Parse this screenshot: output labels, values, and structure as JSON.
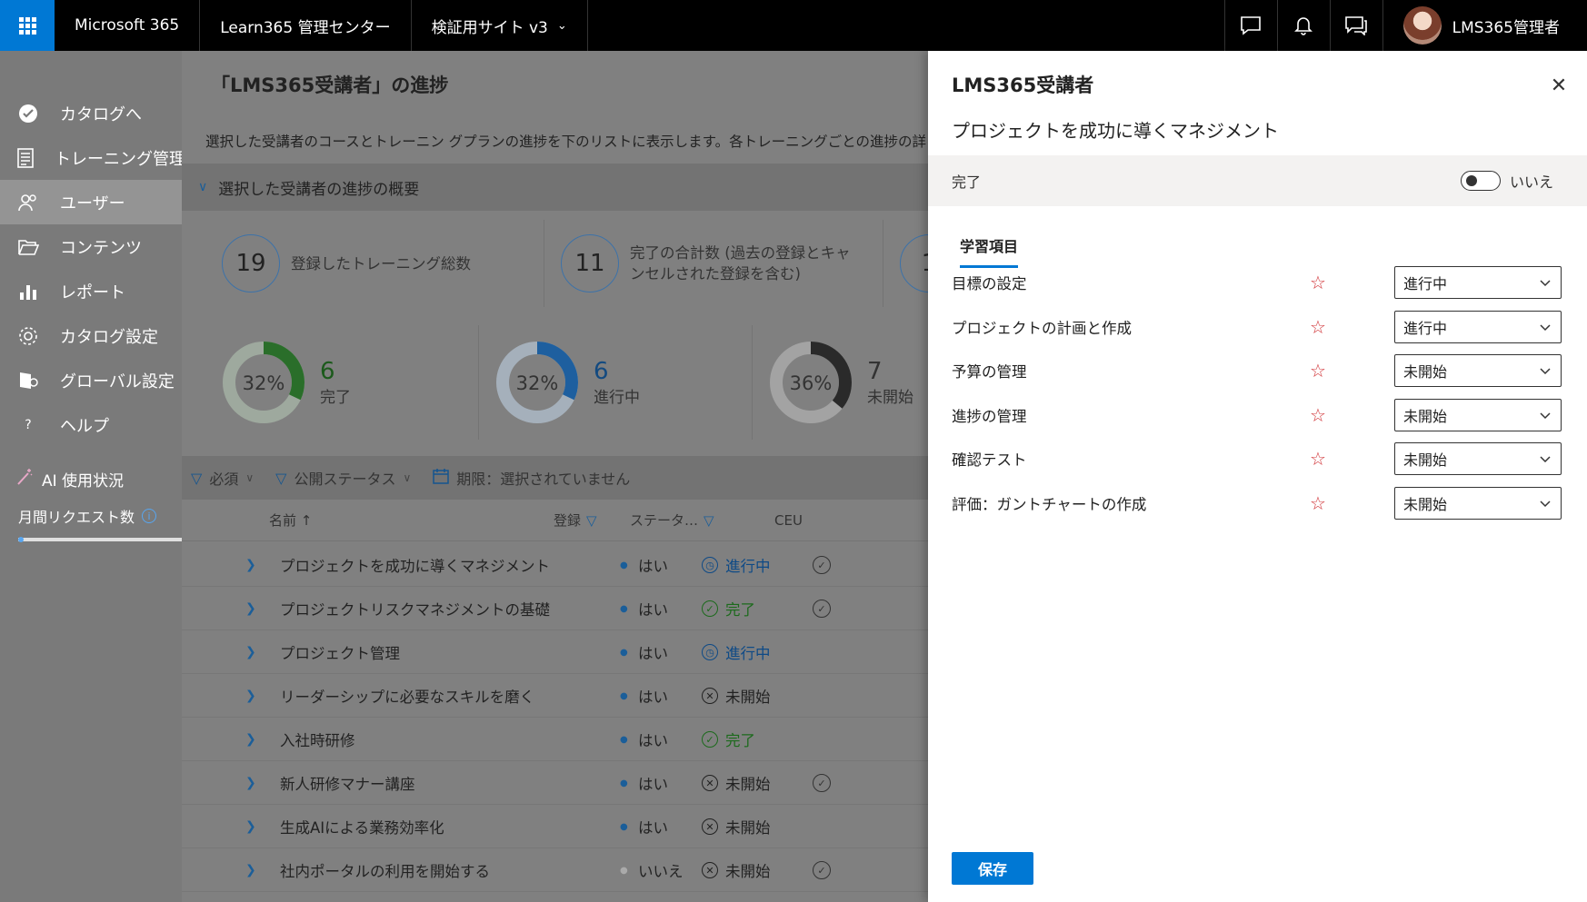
{
  "topbar": {
    "brand": "Microsoft 365",
    "app": "Learn365 管理センター",
    "site": "検証用サイト v3",
    "user": "LMS365管理者"
  },
  "sidebar": {
    "items": [
      {
        "label": "カタログへ",
        "icon": "check-circle-icon"
      },
      {
        "label": "トレーニング管理",
        "icon": "training-doc-icon"
      },
      {
        "label": "ユーザー",
        "icon": "users-icon",
        "active": true
      },
      {
        "label": "コンテンツ",
        "icon": "folder-open-icon"
      },
      {
        "label": "レポート",
        "icon": "bar-chart-icon"
      },
      {
        "label": "カタログ設定",
        "icon": "gear-icon"
      },
      {
        "label": "グローバル設定",
        "icon": "global-settings-icon"
      },
      {
        "label": "ヘルプ",
        "icon": "help-icon"
      }
    ],
    "ai_usage": "AI 使用状況",
    "monthly_requests": "月間リクエスト数"
  },
  "main": {
    "title": "「LMS365受講者」の進捗",
    "description": "選択した受講者のコースとトレーニン グプランの進捗を下のリストに表示します。各トレーニングごとの進捗の詳",
    "summary_header": "選択した受講者の進捗の概要",
    "stat_cards": [
      {
        "value": "19",
        "label_1": "登録したトレーニング総数",
        "label_2": ""
      },
      {
        "value": "11",
        "label_1": "完了の合計数 (過去の登録とキャ",
        "label_2": "ンセルされた登録を含む)"
      },
      {
        "value": "1",
        "label_1": "",
        "label_2": ""
      }
    ],
    "kpis": [
      {
        "percent_label": "32%",
        "fraction": 0.32,
        "count": "6",
        "label": "完了",
        "color": "#2a6e2a",
        "track": "#9ea99e",
        "num_color": "#1c5a1c"
      },
      {
        "percent_label": "32%",
        "fraction": 0.32,
        "count": "6",
        "label": "進行中",
        "color": "#1e5f9f",
        "track": "#a5b0bb",
        "num_color": "#134a80"
      },
      {
        "percent_label": "36%",
        "fraction": 0.36,
        "count": "7",
        "label": "未開始",
        "color": "#2a2a2a",
        "track": "#a3a3a3",
        "num_color": "#333333"
      }
    ],
    "filters": {
      "required": "必須",
      "publish_status": "公開ステータス",
      "due": "期限：選択されていません"
    },
    "columns": {
      "name": "名前 ↑",
      "registered": "登録",
      "status": "ステータ…",
      "ceu": "CEU"
    },
    "rows": [
      {
        "name": "プロジェクトを成功に導くマネジメント",
        "reg": "はい",
        "status": "進行中",
        "kind": "prog",
        "ceu": true
      },
      {
        "name": "プロジェクトリスクマネジメントの基礎",
        "reg": "はい",
        "status": "完了",
        "kind": "done",
        "ceu": true
      },
      {
        "name": "プロジェクト管理",
        "reg": "はい",
        "status": "進行中",
        "kind": "prog",
        "ceu": false
      },
      {
        "name": "リーダーシップに必要なスキルを磨く",
        "reg": "はい",
        "status": "未開始",
        "kind": "ns",
        "ceu": false
      },
      {
        "name": "入社時研修",
        "reg": "はい",
        "status": "完了",
        "kind": "done",
        "ceu": false
      },
      {
        "name": "新人研修マナー講座",
        "reg": "はい",
        "status": "未開始",
        "kind": "ns",
        "ceu": true
      },
      {
        "name": "生成AIによる業務効率化",
        "reg": "はい",
        "status": "未開始",
        "kind": "ns",
        "ceu": false
      },
      {
        "name": "社内ポータルの利用を開始する",
        "reg": "いいえ",
        "status": "未開始",
        "kind": "ns",
        "ceu": true
      }
    ]
  },
  "panel": {
    "title": "LMS365受講者",
    "subtitle": "プロジェクトを成功に導くマネジメント",
    "complete_label": "完了",
    "toggle_label": "いいえ",
    "tab": "学習項目",
    "items": [
      {
        "name": "目標の設定",
        "status": "進行中"
      },
      {
        "name": "プロジェクトの計画と作成",
        "status": "進行中"
      },
      {
        "name": "予算の管理",
        "status": "未開始"
      },
      {
        "name": "進捗の管理",
        "status": "未開始"
      },
      {
        "name": "確認テスト",
        "status": "未開始"
      },
      {
        "name": "評価：ガントチャートの作成",
        "status": "未開始"
      }
    ],
    "save": "保存"
  }
}
